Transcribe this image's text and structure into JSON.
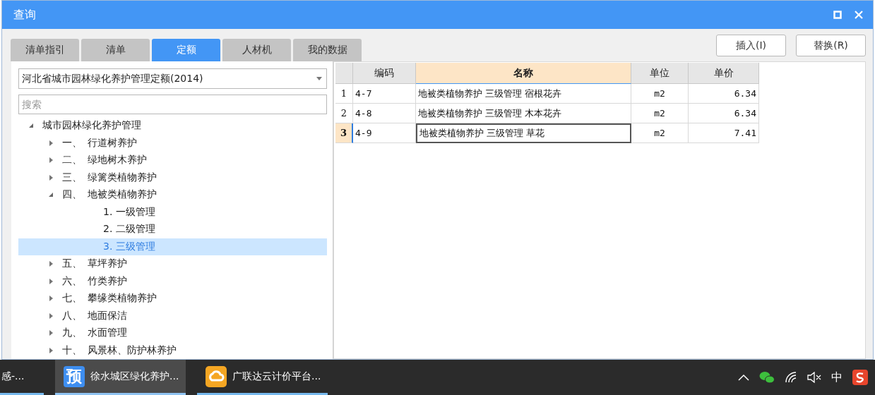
{
  "window": {
    "title": "查询"
  },
  "tabs": [
    {
      "label": "清单指引",
      "selected": false
    },
    {
      "label": "清单",
      "selected": false
    },
    {
      "label": "定额",
      "selected": true
    },
    {
      "label": "人材机",
      "selected": false
    },
    {
      "label": "我的数据",
      "selected": false
    }
  ],
  "library_select": {
    "value": "河北省城市园林绿化养护管理定额(2014)"
  },
  "search": {
    "placeholder": "搜索"
  },
  "tree": [
    {
      "label": "城市园林绿化养护管理",
      "expanded": true,
      "selected": false,
      "children": [
        {
          "number": "一、",
          "label": "行道树养护",
          "expanded": false,
          "selected": false
        },
        {
          "number": "二、",
          "label": "绿地树木养护",
          "expanded": false,
          "selected": false
        },
        {
          "number": "三、",
          "label": "绿篱类植物养护",
          "expanded": false,
          "selected": false
        },
        {
          "number": "四、",
          "label": "地被类植物养护",
          "expanded": true,
          "selected": false,
          "children": [
            {
              "label": "1. 一级管理",
              "selected": false
            },
            {
              "label": "2. 二级管理",
              "selected": false
            },
            {
              "label": "3. 三级管理",
              "selected": true
            }
          ]
        },
        {
          "number": "五、",
          "label": "草坪养护",
          "expanded": false,
          "selected": false
        },
        {
          "number": "六、",
          "label": "竹类养护",
          "expanded": false,
          "selected": false
        },
        {
          "number": "七、",
          "label": "攀缘类植物养护",
          "expanded": false,
          "selected": false
        },
        {
          "number": "八、",
          "label": "地面保洁",
          "expanded": false,
          "selected": false
        },
        {
          "number": "九、",
          "label": "水面管理",
          "expanded": false,
          "selected": false
        },
        {
          "number": "十、",
          "label": "风景林、防护林养护",
          "expanded": false,
          "selected": false
        }
      ]
    }
  ],
  "buttons": [
    "插入(I)",
    "替换(R)"
  ],
  "table": {
    "columns": [
      {
        "label": "编码",
        "selected": false
      },
      {
        "label": "名称",
        "selected": true
      },
      {
        "label": "单位",
        "selected": false
      },
      {
        "label": "单价",
        "selected": false
      }
    ],
    "rows": [
      {
        "index": "1",
        "code": "4-7",
        "name": "地被类植物养护 三级管理 宿根花卉",
        "unit": "m2",
        "price": "6.34",
        "selected": false
      },
      {
        "index": "2",
        "code": "4-8",
        "name": "地被类植物养护 三级管理 木本花卉",
        "unit": "m2",
        "price": "6.34",
        "selected": false
      },
      {
        "index": "3",
        "code": "4-9",
        "name": "地被类植物养护 三级管理 草花",
        "unit": "m2",
        "price": "7.41",
        "selected": true
      }
    ]
  },
  "taskbar": {
    "items": [
      {
        "kind": "none",
        "label": "感-...",
        "active": false
      },
      {
        "kind": "glyph",
        "glyph": "预",
        "label": "徐水城区绿化养护...",
        "active": true
      },
      {
        "kind": "cloud",
        "label": "广联达云计价平台...",
        "active": false
      }
    ],
    "input_method": "中"
  }
}
